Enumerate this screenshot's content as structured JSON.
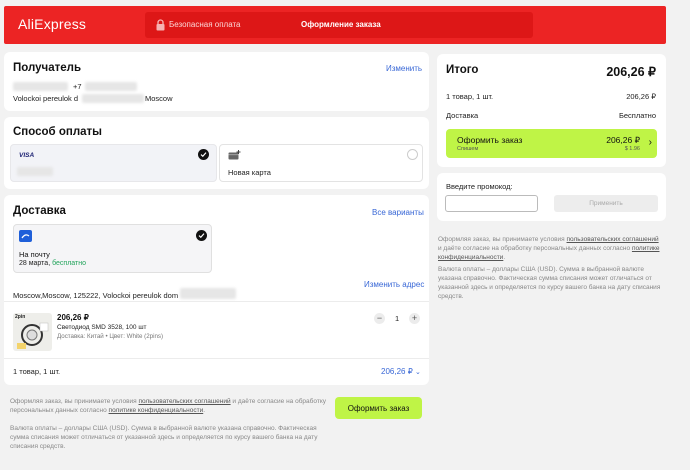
{
  "header": {
    "logo": "AliExpress",
    "safe_payment": "Безопасная оплата",
    "title": "Оформление заказа"
  },
  "recipient": {
    "title": "Получатель",
    "edit_link": "Изменить",
    "phone_prefix": "+7",
    "address_start": "Volockoi pereulok d",
    "address_city": "Moscow"
  },
  "payment": {
    "title": "Способ оплаты",
    "card_brand": "VISA",
    "new_card": "Новая карта"
  },
  "delivery": {
    "title": "Доставка",
    "all_options_link": "Все варианты",
    "option_name": "На почту",
    "option_date": "28 марта,",
    "option_price": "бесплатно",
    "address": "Moscow,Moscow, 125222, Volockoi pereulok dom",
    "change_address_link": "Изменить адрес",
    "product": {
      "image_label": "2pin",
      "price": "206,26 ₽",
      "name": "Светодиод SMD 3528, 100 шт",
      "details": "Доставка: Китай • Цвет: White (2pins)",
      "quantity": "1",
      "minus": "−",
      "plus": "+"
    },
    "summary_count": "1 товар, 1 шт.",
    "summary_price": "206,26 ₽"
  },
  "bottom": {
    "terms_1": "Оформляя заказ, вы принимаете условия",
    "terms_link_1": "пользовательских соглашений",
    "terms_2": "и даёте согласие на обработку персональных данных согласно",
    "terms_link_2": "политике конфиденциальности",
    "currency_note": "Валюта оплаты – доллары США (USD). Сумма в выбранной валюте указана справочно. Фактическая сумма списания может отличаться от указанной здесь и определяется по курсу вашего банка на дату списания средств.",
    "order_button": "Оформить заказ"
  },
  "summary": {
    "title": "Итого",
    "total": "206,26 ₽",
    "items_label": "1 товар, 1 шт.",
    "items_value": "206,26 ₽",
    "delivery_label": "Доставка",
    "delivery_value": "Бесплатно",
    "order_button": "Оформить заказ",
    "order_button_sub": "Спишем",
    "order_button_price": "206,26 ₽",
    "order_button_usd": "$ 1.96"
  },
  "promo": {
    "label": "Введите промокод:",
    "placeholder": "",
    "apply_button": "Применить"
  },
  "side_notes": {
    "terms_1": "Оформляя заказ, вы принимаете условия",
    "terms_link_1": "пользовательских соглашений",
    "terms_2": "и даёте согласие на обработку персональных данных согласно",
    "terms_link_2": "политике конфиденциальности",
    "currency_note": "Валюта оплаты – доллары США (USD). Сумма в выбранной валюте указана справочно. Фактическая сумма списания может отличаться от указанной здесь и определяется по курсу вашего банка на дату списания средств."
  },
  "colors": {
    "brand_red": "#ec2424",
    "accent_green": "#bff446",
    "link_blue": "#3867d6",
    "success_green": "#20a35a"
  }
}
